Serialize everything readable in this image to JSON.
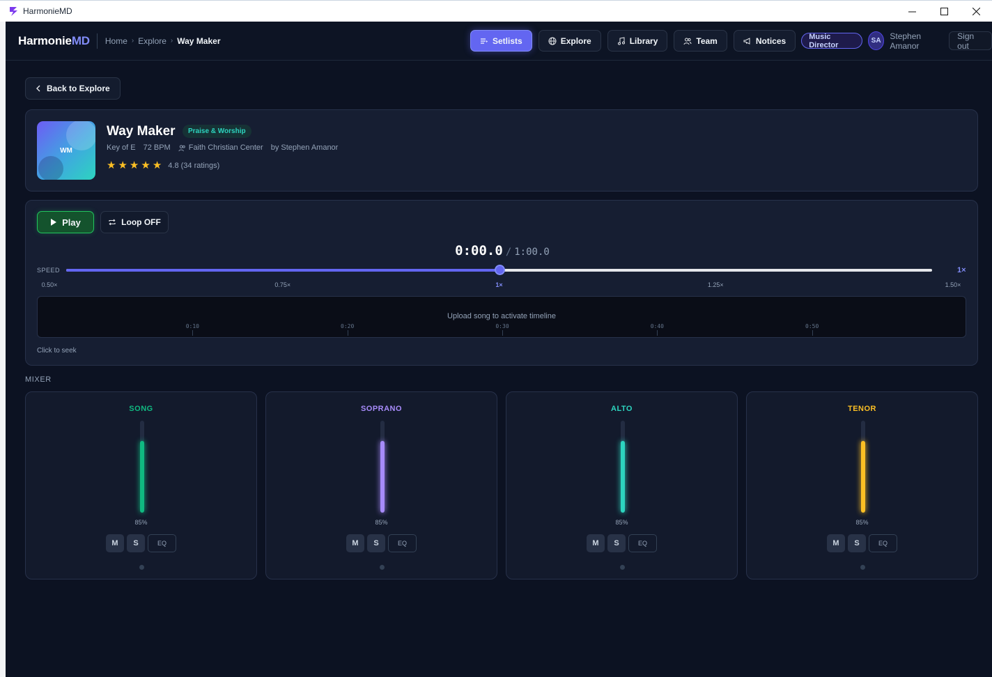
{
  "window": {
    "title": "HarmonieMD"
  },
  "nav": {
    "logo_main": "Harmonie",
    "logo_accent": "MD",
    "breadcrumb": [
      "Home",
      "Explore",
      "Way Maker"
    ],
    "buttons": [
      {
        "label": "Setlists",
        "icon": "setlist-icon",
        "active": true
      },
      {
        "label": "Explore",
        "icon": "globe-icon",
        "active": false
      },
      {
        "label": "Library",
        "icon": "music-note-icon",
        "active": false
      },
      {
        "label": "Team",
        "icon": "users-icon",
        "active": false
      },
      {
        "label": "Notices",
        "icon": "megaphone-icon",
        "active": false
      }
    ],
    "role": "Music Director",
    "avatar_initials": "SA",
    "user_name": "Stephen Amanor",
    "signout": "Sign out"
  },
  "back_button": "Back to Explore",
  "song": {
    "art_initials": "WM",
    "title": "Way Maker",
    "genre": "Praise & Worship",
    "key": "Key of E",
    "bpm": "72 BPM",
    "church": "Faith Christian Center",
    "author": "by Stephen Amanor",
    "stars": 5,
    "rating_text": "4.8 (34 ratings)"
  },
  "player": {
    "play_label": "Play",
    "loop_label": "Loop OFF",
    "current_time": "0:00.0",
    "separator": "/",
    "total_time": "1:00.0",
    "speed_label": "SPEED",
    "speed_value": "1×",
    "speed_fraction": 0.5,
    "ticks": [
      {
        "label": "0.50×",
        "pos": 0.0,
        "active": false
      },
      {
        "label": "0.75×",
        "pos": 0.25,
        "active": false
      },
      {
        "label": "1×",
        "pos": 0.5,
        "active": true
      },
      {
        "label": "1.25×",
        "pos": 0.75,
        "active": false
      },
      {
        "label": "1.50×",
        "pos": 1.0,
        "active": false
      }
    ],
    "timeline_message": "Upload song to activate timeline",
    "timeline_marks": [
      "0:10",
      "0:20",
      "0:30",
      "0:40",
      "0:50"
    ],
    "seek_hint": "Click to seek"
  },
  "mixer": {
    "label": "MIXER",
    "channels": [
      {
        "name": "SONG",
        "color": "#10b981",
        "volume": 0.85,
        "volume_text": "85%",
        "mute": "M",
        "solo": "S",
        "eq": "EQ"
      },
      {
        "name": "SOPRANO",
        "color": "#a78bfa",
        "volume": 0.85,
        "volume_text": "85%",
        "mute": "M",
        "solo": "S",
        "eq": "EQ"
      },
      {
        "name": "ALTO",
        "color": "#2dd4bf",
        "volume": 0.85,
        "volume_text": "85%",
        "mute": "M",
        "solo": "S",
        "eq": "EQ"
      },
      {
        "name": "TENOR",
        "color": "#fbbf24",
        "volume": 0.85,
        "volume_text": "85%",
        "mute": "M",
        "solo": "S",
        "eq": "EQ"
      }
    ]
  }
}
